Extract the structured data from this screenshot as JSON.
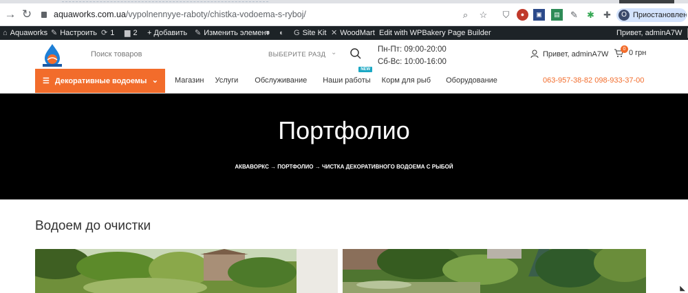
{
  "browser": {
    "url_domain": "aquaworks.com.ua",
    "url_path": "/vypolnennyye-raboty/chistka-vodoema-s-ryboj/",
    "profile_initial": "O",
    "profile_label": "Приостановлена"
  },
  "adminbar": {
    "site": "Aquaworks",
    "customize": "Настроить",
    "updates": "1",
    "comments": "2",
    "new": "+ Добавить",
    "edit": "Изменить элемент",
    "sitekit": "Site Kit",
    "woodmart": "WoodMart",
    "wpbakery": "Edit with WPBakery Page Builder",
    "greeting": "Привет, adminA7W"
  },
  "header": {
    "search_placeholder": "Поиск товаров",
    "category_select": "ВЫБЕРИТЕ РАЗД",
    "hours_weekdays": "Пн-Пт: 09:00-20:00",
    "hours_weekend": "Сб-Вс: 10:00-16:00",
    "account": "Привет, adminA7W",
    "cart_count": "0",
    "cart_total": "0 грн",
    "category_button": "Декоративные водоемы",
    "menu": [
      "Магазин",
      "Услуги",
      "Обслуживание",
      "Наши работы",
      "Корм для рыб",
      "Оборудование"
    ],
    "new_badge": "NEW",
    "phones": "063-957-38-82 098-933-37-00"
  },
  "hero": {
    "title": "Портфолио",
    "breadcrumb": "Акваворкс → Портфолио → Чистка декоративного водоема с рыбой"
  },
  "content": {
    "section_title": "Водоем до очистки"
  },
  "colors": {
    "accent": "#f26c2b",
    "badge": "#1ba8c4",
    "adminbar": "#1d2327"
  }
}
